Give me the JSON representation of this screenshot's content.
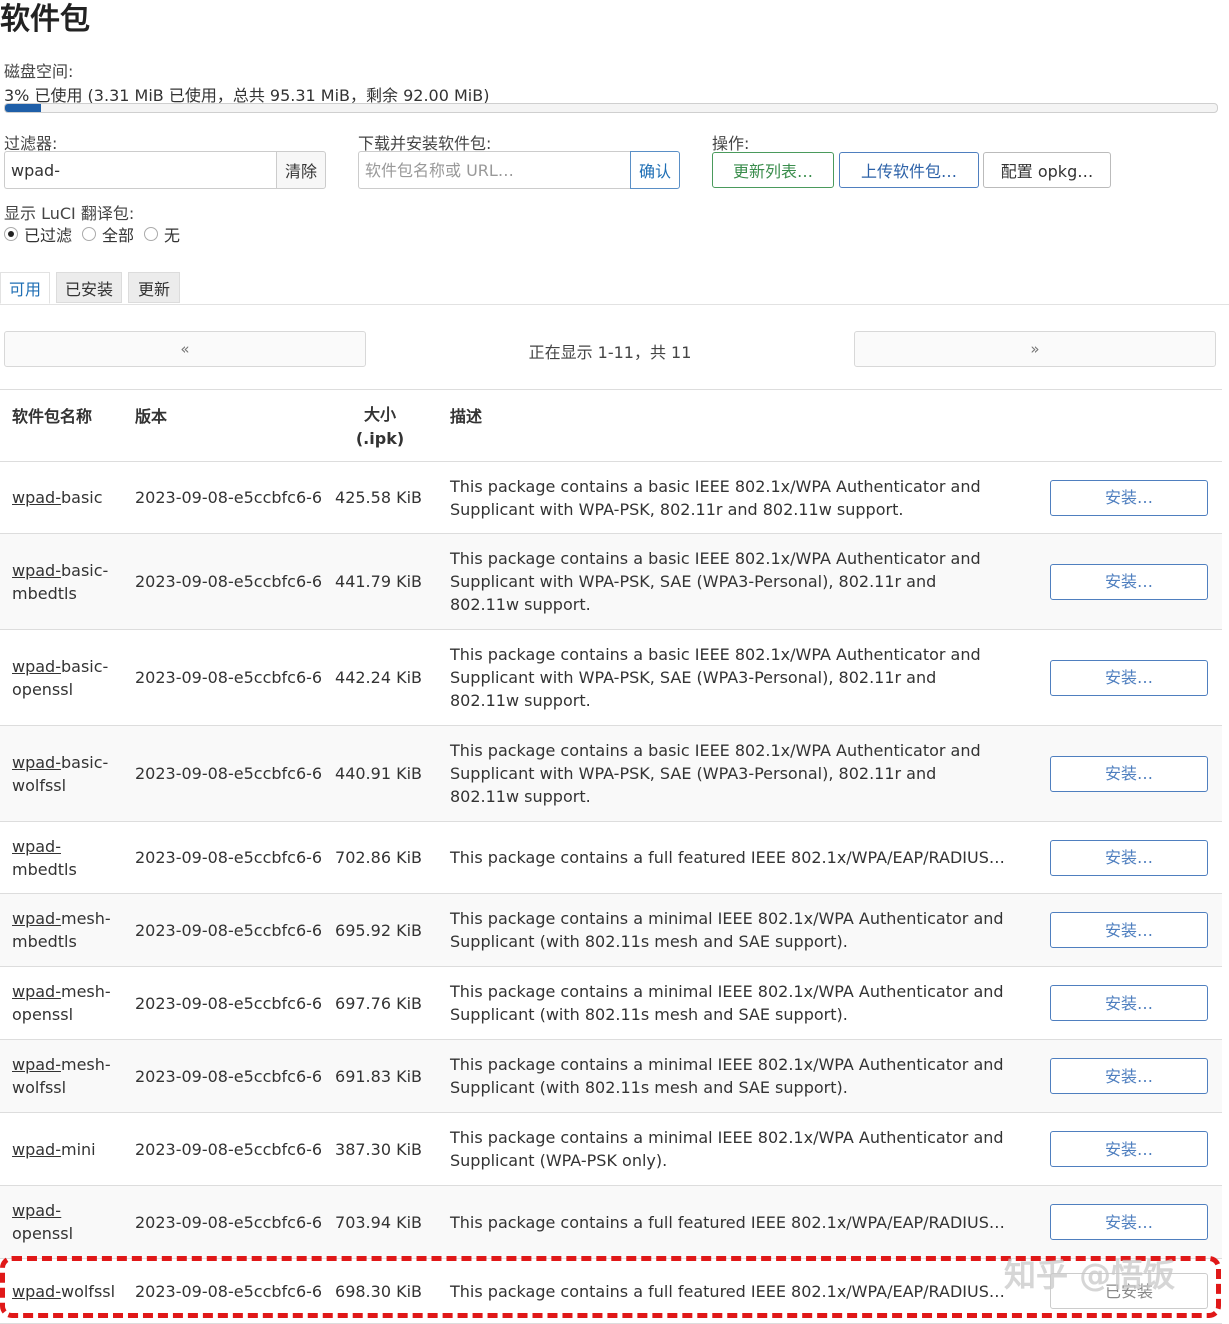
{
  "title": "软件包",
  "disk": {
    "label": "磁盘空间:",
    "usage_text": "3% 已使用 (3.31 MiB 已使用，总共 95.31 MiB，剩余 92.00 MiB)",
    "usage_fraction": 0.03
  },
  "filter": {
    "label": "过滤器:",
    "value": "wpad-",
    "clear_label": "清除"
  },
  "download": {
    "label": "下载并安装软件包:",
    "placeholder": "软件包名称或 URL…",
    "confirm_label": "确认"
  },
  "actions": {
    "label": "操作:",
    "update_label": "更新列表…",
    "upload_label": "上传软件包…",
    "config_label": "配置 opkg…"
  },
  "luci": {
    "label": "显示 LuCI 翻译包:",
    "options": [
      "已过滤",
      "全部",
      "无"
    ],
    "selected": "已过滤"
  },
  "tabs": [
    "可用",
    "已安装",
    "更新"
  ],
  "pager": {
    "prev": "«",
    "next": "»",
    "status": "正在显示 1-11，共 11"
  },
  "table": {
    "headers": {
      "name": "软件包名称",
      "version": "版本",
      "size": "大小 (.ipk)",
      "description": "描述"
    },
    "rows": [
      {
        "name_prefix": "wpad-",
        "name_suffix": "basic",
        "version": "2023-09-08-e5ccbfc6-6",
        "size": "425.58 KiB",
        "description": "This package contains a basic IEEE 802.1x/WPA Authenticator and Supplicant with WPA-PSK, 802.11r and 802.11w support.",
        "action": "安装…"
      },
      {
        "name_prefix": "wpad-",
        "name_suffix": "basic-mbedtls",
        "version": "2023-09-08-e5ccbfc6-6",
        "size": "441.79 KiB",
        "description": "This package contains a basic IEEE 802.1x/WPA Authenticator and Supplicant with WPA-PSK, SAE (WPA3-Personal), 802.11r and 802.11w support.",
        "action": "安装…"
      },
      {
        "name_prefix": "wpad-",
        "name_suffix": "basic-openssl",
        "version": "2023-09-08-e5ccbfc6-6",
        "size": "442.24 KiB",
        "description": "This package contains a basic IEEE 802.1x/WPA Authenticator and Supplicant with WPA-PSK, SAE (WPA3-Personal), 802.11r and 802.11w support.",
        "action": "安装…"
      },
      {
        "name_prefix": "wpad-",
        "name_suffix": "basic-wolfssl",
        "version": "2023-09-08-e5ccbfc6-6",
        "size": "440.91 KiB",
        "description": "This package contains a basic IEEE 802.1x/WPA Authenticator and Supplicant with WPA-PSK, SAE (WPA3-Personal), 802.11r and 802.11w support.",
        "action": "安装…"
      },
      {
        "name_prefix": "wpad-",
        "name_suffix": "mbedtls",
        "version": "2023-09-08-e5ccbfc6-6",
        "size": "702.86 KiB",
        "description": "This package contains a full featured IEEE 802.1x/WPA/EAP/RADIUS…",
        "action": "安装…"
      },
      {
        "name_prefix": "wpad-",
        "name_suffix": "mesh-mbedtls",
        "version": "2023-09-08-e5ccbfc6-6",
        "size": "695.92 KiB",
        "description": "This package contains a minimal IEEE 802.1x/WPA Authenticator and Supplicant (with 802.11s mesh and SAE support).",
        "action": "安装…"
      },
      {
        "name_prefix": "wpad-",
        "name_suffix": "mesh-openssl",
        "version": "2023-09-08-e5ccbfc6-6",
        "size": "697.76 KiB",
        "description": "This package contains a minimal IEEE 802.1x/WPA Authenticator and Supplicant (with 802.11s mesh and SAE support).",
        "action": "安装…"
      },
      {
        "name_prefix": "wpad-",
        "name_suffix": "mesh-wolfssl",
        "version": "2023-09-08-e5ccbfc6-6",
        "size": "691.83 KiB",
        "description": "This package contains a minimal IEEE 802.1x/WPA Authenticator and Supplicant (with 802.11s mesh and SAE support).",
        "action": "安装…"
      },
      {
        "name_prefix": "wpad-",
        "name_suffix": "mini",
        "version": "2023-09-08-e5ccbfc6-6",
        "size": "387.30 KiB",
        "description": "This package contains a minimal IEEE 802.1x/WPA Authenticator and Supplicant (WPA-PSK only).",
        "action": "安装…"
      },
      {
        "name_prefix": "wpad-",
        "name_suffix": "openssl",
        "version": "2023-09-08-e5ccbfc6-6",
        "size": "703.94 KiB",
        "description": "This package contains a full featured IEEE 802.1x/WPA/EAP/RADIUS…",
        "action": "安装…"
      },
      {
        "name_prefix": "wpad-",
        "name_suffix": "wolfssl",
        "version": "2023-09-08-e5ccbfc6-6",
        "size": "698.30 KiB",
        "description": "This package contains a full featured IEEE 802.1x/WPA/EAP/RADIUS…",
        "action": "已安装"
      }
    ]
  },
  "watermark": "知乎 @悟饭",
  "colors": {
    "accent": "#1f6fb5",
    "success": "#3a8d4c",
    "highlight": "#e01818"
  }
}
